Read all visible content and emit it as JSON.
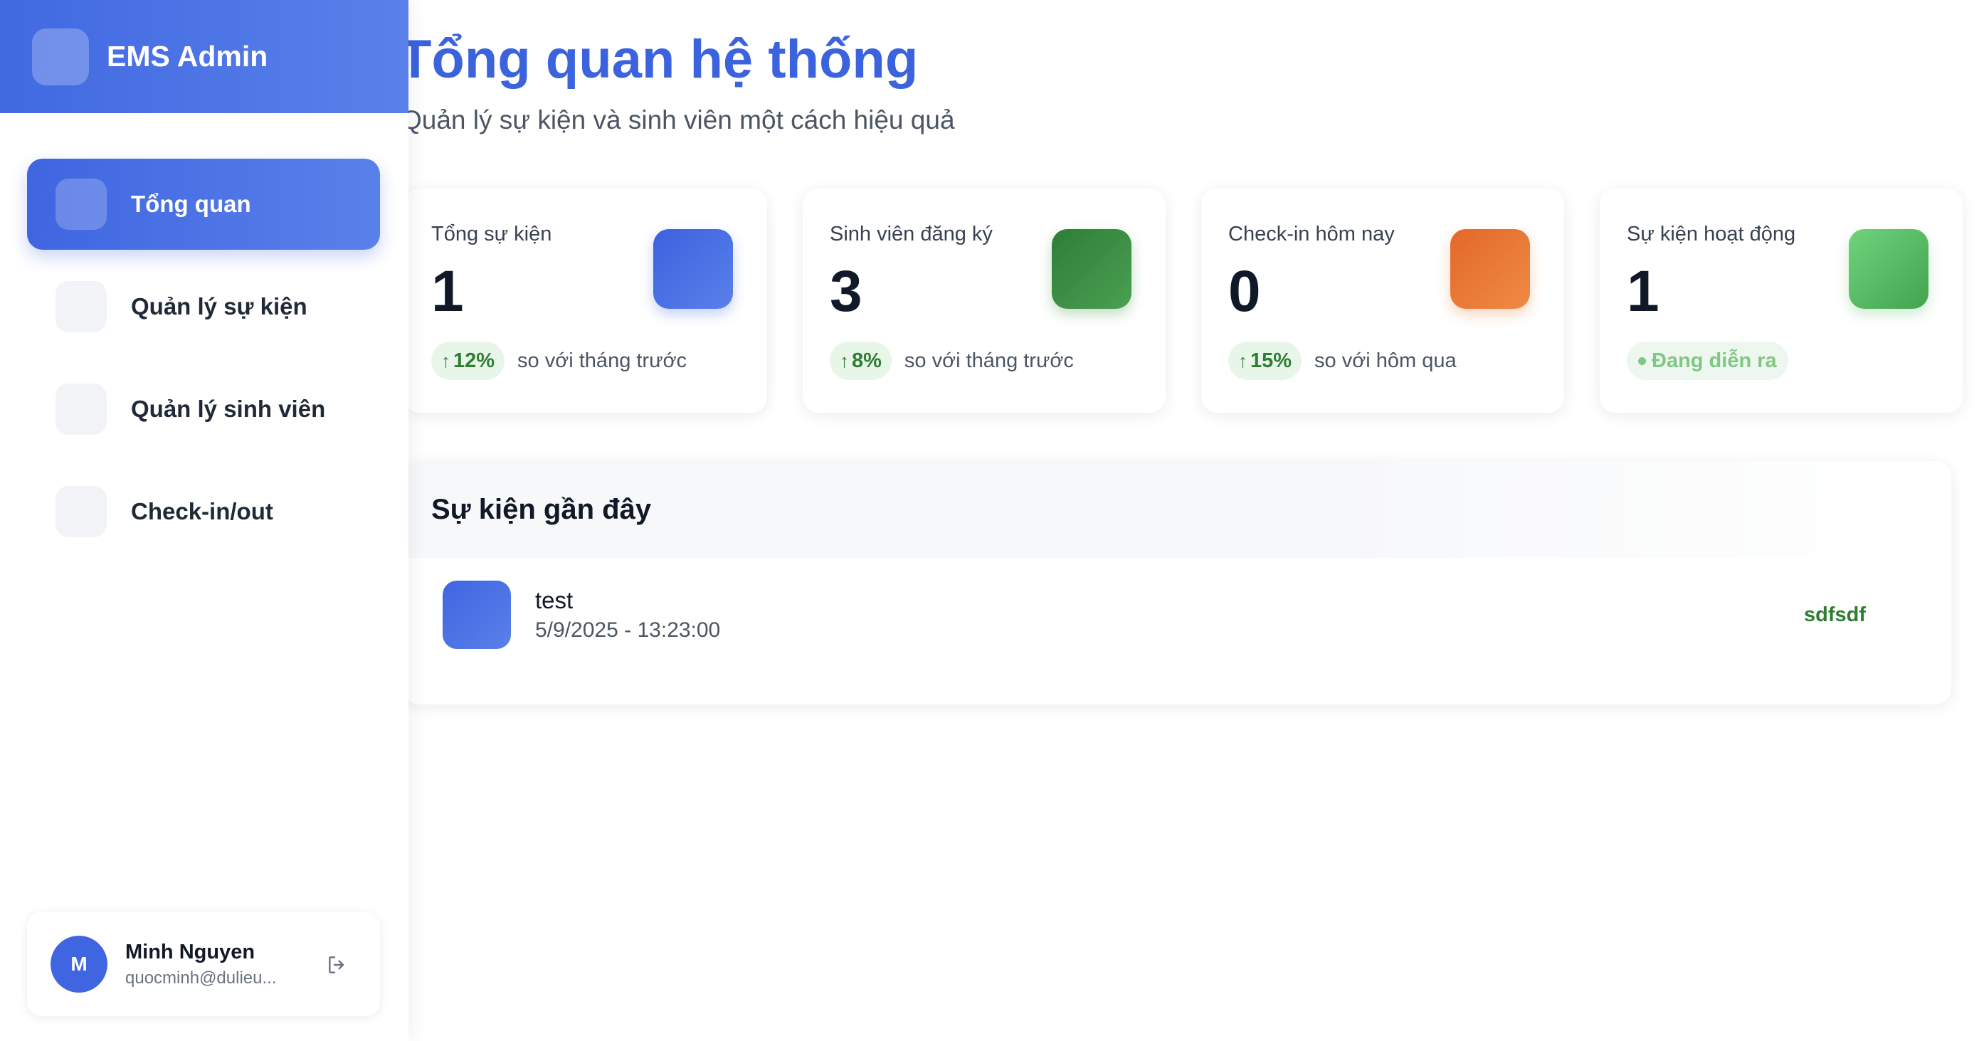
{
  "sidebar": {
    "brand": "EMS Admin",
    "items": [
      {
        "label": "Tổng quan",
        "active": true
      },
      {
        "label": "Quản lý sự kiện",
        "active": false
      },
      {
        "label": "Quản lý sinh viên",
        "active": false
      },
      {
        "label": "Check-in/out",
        "active": false
      }
    ],
    "user": {
      "initial": "M",
      "name": "Minh Nguyen",
      "email": "quocminh@dulieu..."
    }
  },
  "header": {
    "title": "Tổng quan hệ thống",
    "subtitle": "Quản lý sự kiện và sinh viên một cách hiệu quả"
  },
  "stats": [
    {
      "label": "Tổng sự kiện",
      "value": "1",
      "trend": "12%",
      "note": "so với tháng trước",
      "color": "#4169e1"
    },
    {
      "label": "Sinh viên đăng ký",
      "value": "3",
      "trend": "8%",
      "note": "so với tháng trước",
      "color": "#388e3c"
    },
    {
      "label": "Check-in hôm nay",
      "value": "0",
      "trend": "15%",
      "note": "so với hôm qua",
      "color": "#e8732e"
    },
    {
      "label": "Sự kiện hoạt động",
      "value": "1",
      "status": "Đang diễn ra",
      "color": "#5cc06a"
    }
  ],
  "recent_events": {
    "title": "Sự kiện gần đây",
    "items": [
      {
        "name": "test",
        "datetime": "5/9/2025 - 13:23:00",
        "location": "sdfsdf"
      }
    ]
  },
  "icons": {
    "trend": "arrow-up-icon",
    "logout": "logout-icon"
  }
}
